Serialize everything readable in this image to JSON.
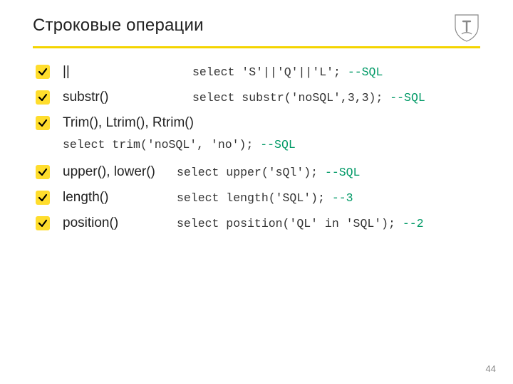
{
  "title": "Строковые операции",
  "page": "44",
  "items": {
    "concat": {
      "label": "||",
      "code": "select 'S'||'Q'||'L'; ",
      "comment": "--SQL"
    },
    "substr": {
      "label": "substr()",
      "code": "select substr('noSQL',3,3); ",
      "comment": "--SQL"
    },
    "trim": {
      "label": "Trim(), Ltrim(), Rtrim()",
      "code": "select trim('noSQL', 'no'); ",
      "comment": "--SQL"
    },
    "upper": {
      "label": "upper(), lower()",
      "code": "select upper('sQl'); ",
      "comment": "--SQL"
    },
    "length": {
      "label": "length()",
      "code": "select length('SQL'); ",
      "comment": "--3"
    },
    "position": {
      "label": "position()",
      "code": "select position('QL' in 'SQL'); ",
      "comment": "--2"
    }
  }
}
